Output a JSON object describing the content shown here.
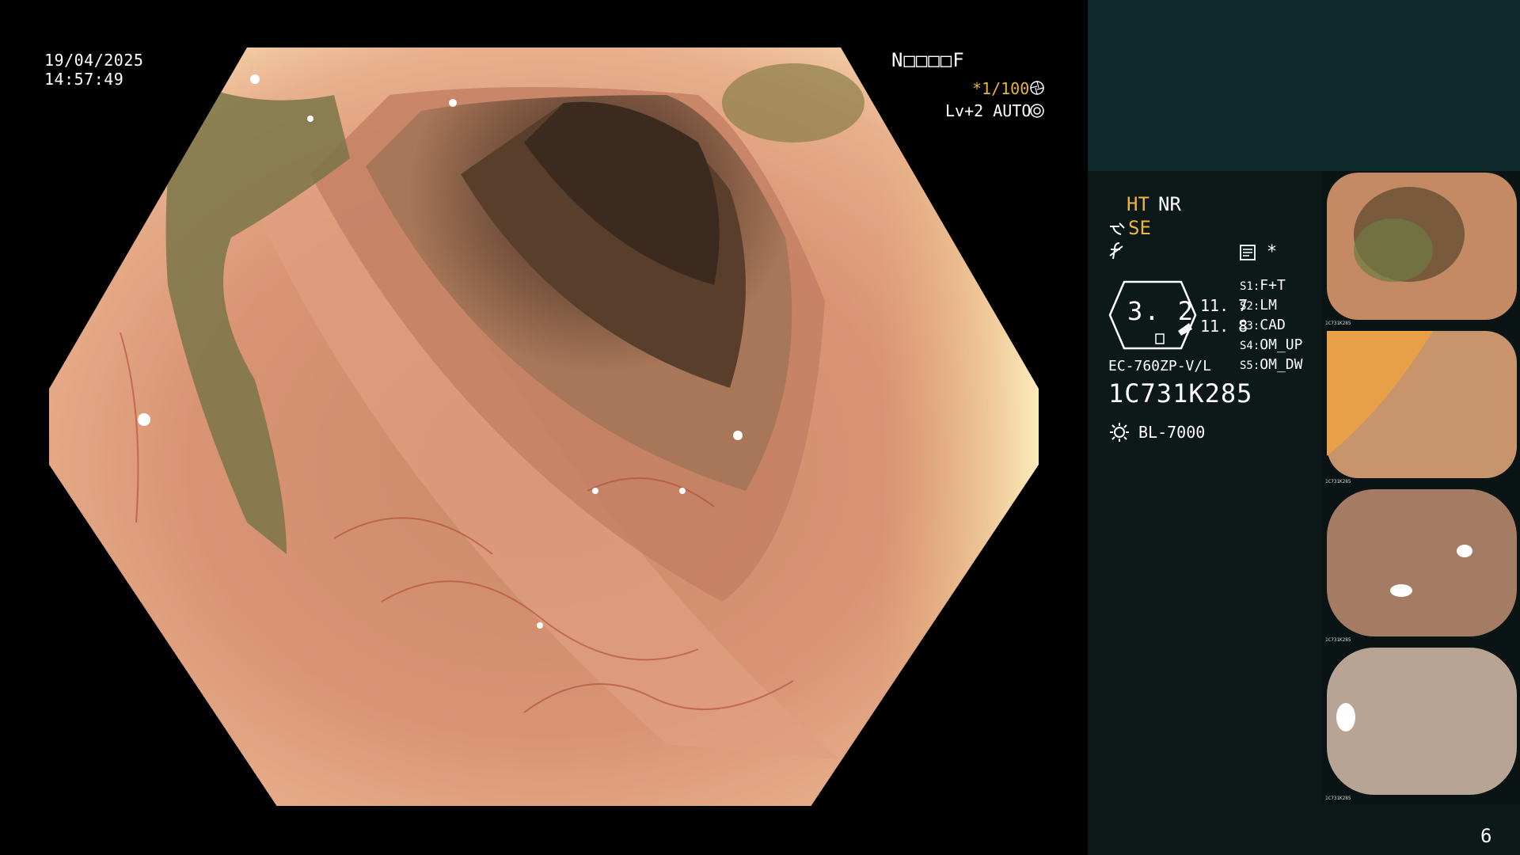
{
  "overlay": {
    "date": "19/04/2025",
    "time": "14:57:49",
    "patient_id": "N□□□□F",
    "shutter": "*1/100",
    "shutter_icon": "aperture-icon",
    "level": "Lv+2 AUTO",
    "auto_icon": "auto-iris-icon"
  },
  "panel": {
    "mode_ht": "HT",
    "mode_nr": "NR",
    "mode_se": "SE",
    "se_icon": "structure-enhance-icon",
    "f_icon": "freeze-icon",
    "memo_icon": "memo-icon",
    "star": "*",
    "gauge_value": "3. 2",
    "value_top": "11. 7",
    "value_bottom": "11. 8",
    "switches": [
      {
        "key": "S1:",
        "value": "F+T"
      },
      {
        "key": "S2:",
        "value": "LM"
      },
      {
        "key": "S3:",
        "value": "CAD"
      },
      {
        "key": "S4:",
        "value": "OM_UP"
      },
      {
        "key": "S5:",
        "value": "OM_DW"
      }
    ],
    "scope_model": "EC-760ZP-V/L",
    "serial": "1C731K285",
    "light_icon": "light-source-icon",
    "light_source": "BL-7000"
  },
  "thumbnails": [
    {
      "label": "1C731K285"
    },
    {
      "label": "1C731K285"
    },
    {
      "label": "1C731K285"
    },
    {
      "label": "1C731K285"
    }
  ],
  "page_number": "6",
  "colors": {
    "panel_top": "#0f2a2a",
    "panel_main": "#0d1918",
    "accent_yellow": "#f2b43a",
    "mucosa": "#d99474"
  }
}
